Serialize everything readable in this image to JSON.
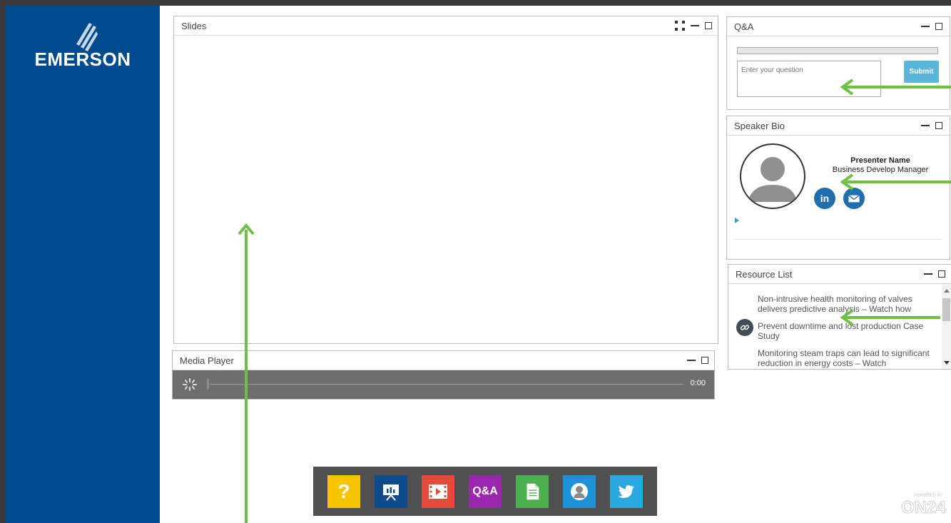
{
  "brand": {
    "name": "EMERSON"
  },
  "slides": {
    "title": "Slides"
  },
  "media_player": {
    "title": "Media Player",
    "time": "0:00"
  },
  "qa": {
    "title": "Q&A",
    "placeholder": "Enter your question",
    "submit_label": "Submit"
  },
  "speaker_bio": {
    "title": "Speaker Bio",
    "name": "Presenter Name",
    "role": "Business Develop Manager"
  },
  "resource_list": {
    "title": "Resource List",
    "items": [
      {
        "text": "Non-intrusive health monitoring of valves delivers predictive analysis – Watch how"
      },
      {
        "text": "Prevent downtime and lost production Case Study"
      },
      {
        "text": "Monitoring steam traps can lead to significant reduction in energy costs – Watch"
      }
    ]
  },
  "toolbar": {
    "items": [
      {
        "label": "?",
        "icon": "help-icon",
        "color": "#f7c400"
      },
      {
        "label": "",
        "icon": "slides-icon",
        "color": "#0e4a8c"
      },
      {
        "label": "",
        "icon": "media-player-icon",
        "color": "#e64a3b"
      },
      {
        "label": "Q&A",
        "icon": "qa-icon",
        "color": "#9b27af"
      },
      {
        "label": "",
        "icon": "resource-list-icon",
        "color": "#4caf50"
      },
      {
        "label": "",
        "icon": "speaker-bio-icon",
        "color": "#1e90d8"
      },
      {
        "label": "",
        "icon": "twitter-icon",
        "color": "#2aa9e0"
      }
    ]
  },
  "footer": {
    "powered_by": "POWERED BY",
    "vendor": "ON24"
  },
  "colors": {
    "sidebar": "#004b8d",
    "accent_arrow": "#70bf45",
    "submit": "#5bb4da"
  }
}
